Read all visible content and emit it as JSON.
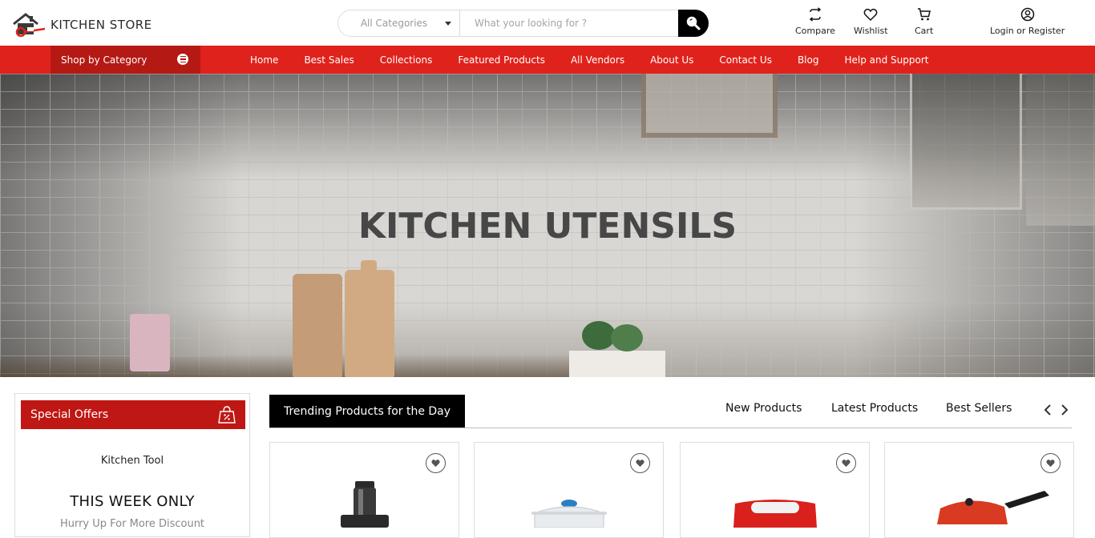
{
  "header": {
    "logo_text": "KITCHEN STORE",
    "search": {
      "category_value": "All Categories",
      "placeholder": "What your looking for ?"
    },
    "actions": [
      {
        "label": "Compare",
        "icon": "compare-icon"
      },
      {
        "label": "Wishlist",
        "icon": "heart-icon"
      },
      {
        "label": "Cart",
        "icon": "cart-icon"
      },
      {
        "label": "Login or Register",
        "icon": "user-icon"
      }
    ]
  },
  "nav": {
    "shop_by_category": "Shop by Category",
    "links": [
      "Home",
      "Best Sales",
      "Collections",
      "Featured Products",
      "All Vendors",
      "About Us",
      "Contact Us",
      "Blog",
      "Help and Support"
    ]
  },
  "hero": {
    "title": "KITCHEN UTENSILS"
  },
  "special_offers": {
    "title": "Special Offers",
    "subtitle": "Kitchen Tool",
    "headline": "THIS WEEK ONLY",
    "hint": "Hurry Up For More Discount"
  },
  "products_section": {
    "active_tab": "Trending Products for the Day",
    "tabs": [
      "New Products",
      "Latest Products",
      "Best Sellers"
    ]
  },
  "colors": {
    "brand_red": "#e0221c",
    "dark_red": "#b51914",
    "black": "#000000"
  }
}
